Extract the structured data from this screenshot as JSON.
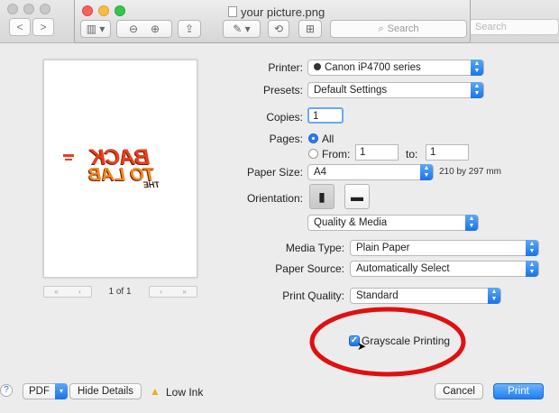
{
  "background_window": {
    "search_placeholder": "Search",
    "nav_back": "<",
    "nav_forward": ">"
  },
  "preview_window": {
    "title": "your picture.png",
    "search_placeholder": "Search",
    "traffic_colors": [
      "#fc605c",
      "#fdbc40",
      "#34c84a"
    ]
  },
  "preview_thumb": {
    "logo_line1": "BACK",
    "logo_line2": "TO LAB",
    "logo_line3": "THE",
    "page_indicator": "1 of 1"
  },
  "print": {
    "printer_label": "Printer:",
    "printer_value": "Canon iP4700 series",
    "presets_label": "Presets:",
    "presets_value": "Default Settings",
    "copies_label": "Copies:",
    "copies_value": "1",
    "pages_label": "Pages:",
    "pages_all": "All",
    "pages_from_label": "From:",
    "pages_from_value": "1",
    "pages_to_label": "to:",
    "pages_to_value": "1",
    "paper_size_label": "Paper Size:",
    "paper_size_value": "A4",
    "paper_size_dims": "210 by 297 mm",
    "orientation_label": "Orientation:",
    "section_value": "Quality & Media",
    "media_type_label": "Media Type:",
    "media_type_value": "Plain Paper",
    "paper_source_label": "Paper Source:",
    "paper_source_value": "Automatically Select",
    "print_quality_label": "Print Quality:",
    "print_quality_value": "Standard",
    "grayscale_label": "Grayscale Printing",
    "grayscale_checked": true
  },
  "footer": {
    "help": "?",
    "pdf": "PDF",
    "hide_details": "Hide Details",
    "low_ink": "Low Ink",
    "cancel": "Cancel",
    "print": "Print"
  },
  "colors": {
    "accent": "#1e7ef0",
    "annotation_circle": "#e01010",
    "warning": "#e8b020"
  }
}
